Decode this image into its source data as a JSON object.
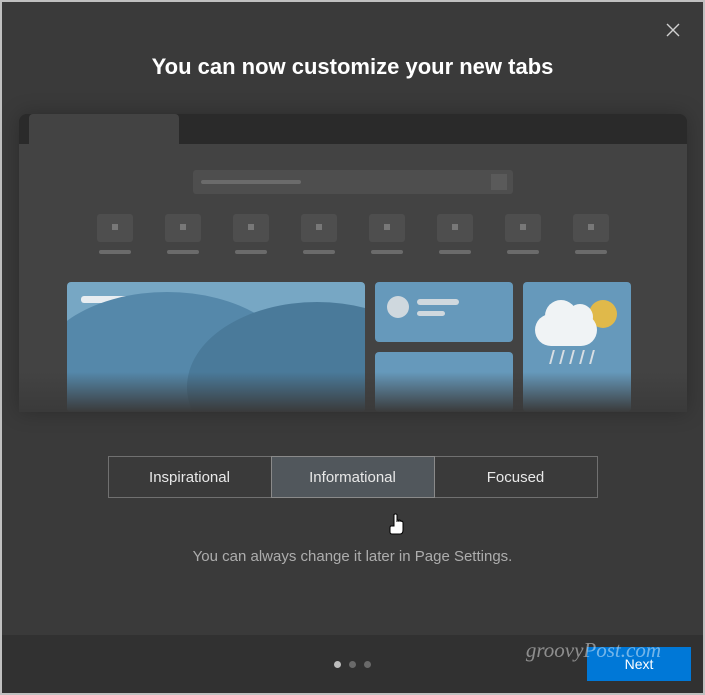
{
  "header": {
    "title": "You can now customize your new tabs"
  },
  "tabs": {
    "items": [
      {
        "label": "Inspirational",
        "active": false
      },
      {
        "label": "Informational",
        "active": true
      },
      {
        "label": "Focused",
        "active": false
      }
    ]
  },
  "hint": "You can always change it later in Page Settings.",
  "pager": {
    "total": 3,
    "active_index": 0
  },
  "footer": {
    "next_label": "Next"
  },
  "watermark": "groovyPost.com",
  "icons": {
    "close": "close-icon",
    "cursor": "pointer-cursor"
  }
}
